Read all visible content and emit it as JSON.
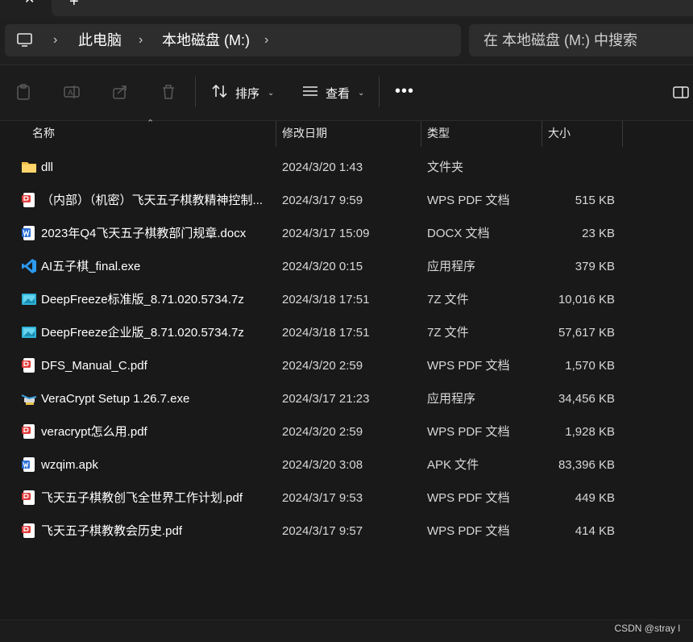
{
  "tabs": {
    "close_glyph": "✕",
    "new_glyph": "+"
  },
  "address": {
    "crumbs": [
      "此电脑",
      "本地磁盘 (M:)"
    ],
    "chevron": "›"
  },
  "search": {
    "placeholder": "在 本地磁盘 (M:) 中搜索"
  },
  "toolbar": {
    "sort_label": "排序",
    "view_label": "查看",
    "more_label": "•••",
    "caret": "⌄"
  },
  "columns": {
    "name": "名称",
    "date": "修改日期",
    "type": "类型",
    "size": "大小",
    "sort_caret": "⌃"
  },
  "files": [
    {
      "name": "dll",
      "date": "2024/3/20 1:43",
      "type": "文件夹",
      "size": "",
      "icon": "folder-icon"
    },
    {
      "name": "（内部）（机密）飞天五子棋教精神控制...",
      "date": "2024/3/17 9:59",
      "type": "WPS PDF 文档",
      "size": "515 KB",
      "icon": "pdf-icon"
    },
    {
      "name": "2023年Q4飞天五子棋教部门规章.docx",
      "date": "2024/3/17 15:09",
      "type": "DOCX 文档",
      "size": "23 KB",
      "icon": "word-icon"
    },
    {
      "name": "AI五子棋_final.exe",
      "date": "2024/3/20 0:15",
      "type": "应用程序",
      "size": "379 KB",
      "icon": "vscode-icon"
    },
    {
      "name": "DeepFreeze标准版_8.71.020.5734.7z",
      "date": "2024/3/18 17:51",
      "type": "7Z 文件",
      "size": "10,016 KB",
      "icon": "archive-icon"
    },
    {
      "name": "DeepFreeze企业版_8.71.020.5734.7z",
      "date": "2024/3/18 17:51",
      "type": "7Z 文件",
      "size": "57,617 KB",
      "icon": "archive-icon"
    },
    {
      "name": "DFS_Manual_C.pdf",
      "date": "2024/3/20 2:59",
      "type": "WPS PDF 文档",
      "size": "1,570 KB",
      "icon": "pdf-icon"
    },
    {
      "name": "VeraCrypt Setup 1.26.7.exe",
      "date": "2024/3/17 21:23",
      "type": "应用程序",
      "size": "34,456 KB",
      "icon": "veracrypt-icon"
    },
    {
      "name": "veracrypt怎么用.pdf",
      "date": "2024/3/20 2:59",
      "type": "WPS PDF 文档",
      "size": "1,928 KB",
      "icon": "pdf-icon"
    },
    {
      "name": "wzqim.apk",
      "date": "2024/3/20 3:08",
      "type": "APK 文件",
      "size": "83,396 KB",
      "icon": "apk-icon"
    },
    {
      "name": "飞天五子棋教创飞全世界工作计划.pdf",
      "date": "2024/3/17 9:53",
      "type": "WPS PDF 文档",
      "size": "449 KB",
      "icon": "pdf-icon"
    },
    {
      "name": "飞天五子棋教教会历史.pdf",
      "date": "2024/3/17 9:57",
      "type": "WPS PDF 文档",
      "size": "414 KB",
      "icon": "pdf-icon"
    }
  ],
  "watermark": "CSDN @stray l",
  "colors": {
    "background": "#191919",
    "folder": "#f5c04a",
    "pdf": "#e03c3c",
    "word": "#2b6fd6",
    "vscode": "#2a9af0"
  }
}
